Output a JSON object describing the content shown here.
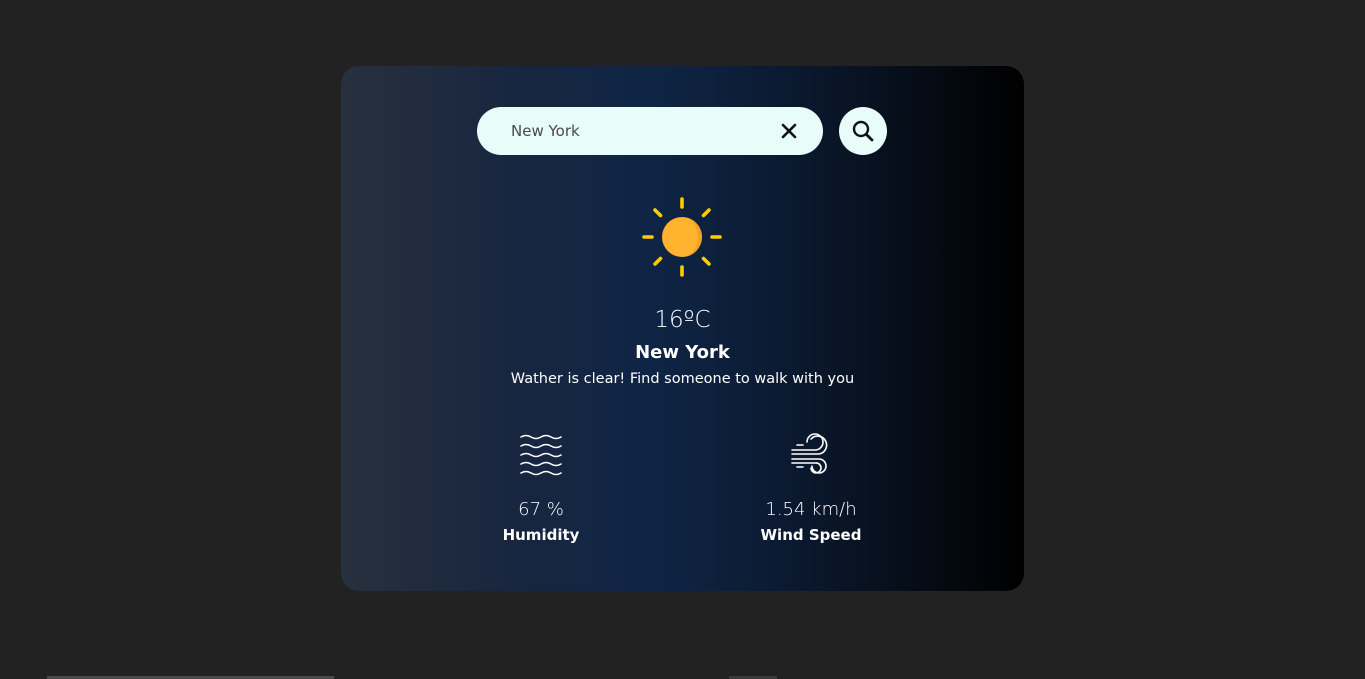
{
  "search": {
    "value": "New York",
    "clear_icon": "close-icon",
    "button_icon": "search-icon"
  },
  "weather": {
    "icon": "sun-icon",
    "temperature": "16ºC",
    "city": "New York",
    "description": "Wather is clear! Find someone to walk with you"
  },
  "details": {
    "humidity": {
      "icon": "humidity-waves-icon",
      "value": "67 %",
      "label": "Humidity"
    },
    "wind": {
      "icon": "wind-icon",
      "value": "1.54 km/h",
      "label": "Wind Speed"
    }
  },
  "colors": {
    "page_background": "#222222",
    "search_background": "#e8fcfa",
    "sun": "#ffb32e",
    "sun_rays": "#ffcc00",
    "text": "#ffffff"
  }
}
